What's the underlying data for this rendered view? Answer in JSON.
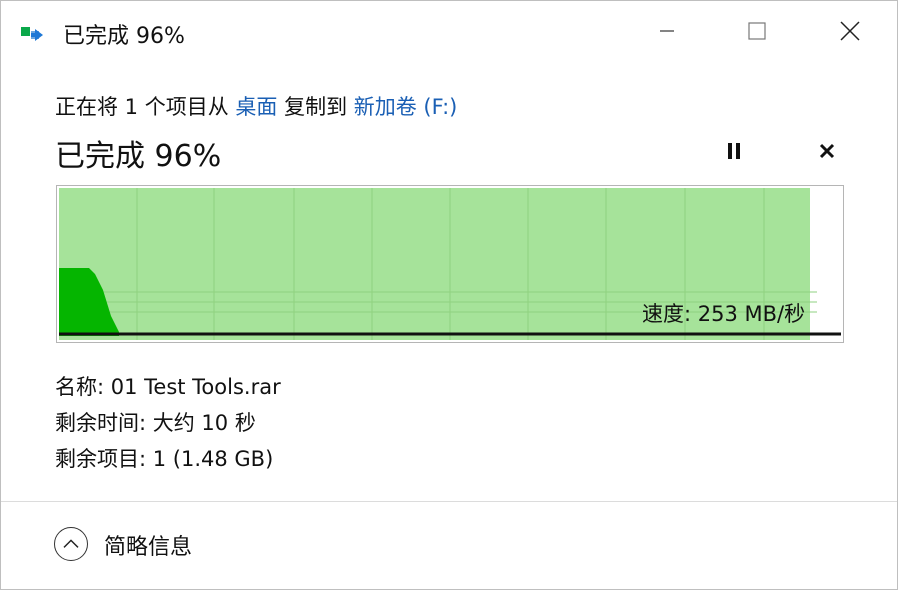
{
  "window": {
    "title": "已完成 96%",
    "icon": "copy-file-icon"
  },
  "titlebar_buttons": {
    "minimize_icon": "minimize-icon",
    "maximize_icon": "maximize-icon",
    "close_icon": "close-icon"
  },
  "description": {
    "prefix": "正在将 1 个项目从 ",
    "source": "桌面",
    "middle": " 复制到 ",
    "destination": "新加卷 (F:)"
  },
  "progress": {
    "heading": "已完成 96%",
    "percent": 96,
    "pause_icon": "pause-icon",
    "cancel_icon": "cancel-icon"
  },
  "graph": {
    "speed_label": "速度: 253 MB/秒",
    "fill_color": "#a6e39a",
    "peak_color": "#05b500",
    "line_color": "#111111"
  },
  "details": {
    "name": "名称: 01 Test Tools.rar",
    "time_remaining": "剩余时间: 大约 10 秒",
    "items_remaining": "剩余项目: 1 (1.48 GB)"
  },
  "footer": {
    "toggle_label": "简略信息",
    "toggle_icon": "chevron-up-icon"
  }
}
